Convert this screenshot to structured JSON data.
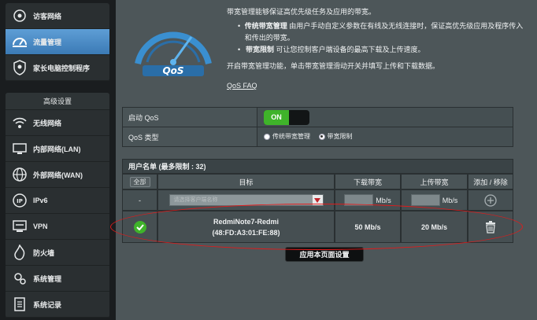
{
  "sidebar": {
    "top_items": [
      {
        "label": "访客网络",
        "icon": "guest-network-icon"
      },
      {
        "label": "流量管理",
        "icon": "traffic-manager-icon",
        "active": true
      },
      {
        "label": "家长电脑控制程序",
        "icon": "parental-control-icon"
      }
    ],
    "advanced_header": "高级设置",
    "advanced_items": [
      {
        "label": "无线网络",
        "icon": "wireless-icon"
      },
      {
        "label": "内部网络(LAN)",
        "icon": "lan-icon"
      },
      {
        "label": "外部网络(WAN)",
        "icon": "wan-icon"
      },
      {
        "label": "IPv6",
        "icon": "ipv6-icon"
      },
      {
        "label": "VPN",
        "icon": "vpn-icon"
      },
      {
        "label": "防火墙",
        "icon": "firewall-icon"
      },
      {
        "label": "系统管理",
        "icon": "administration-icon"
      },
      {
        "label": "系统记录",
        "icon": "system-log-icon"
      }
    ]
  },
  "intro": {
    "line1": "带宽管理能够保证高优先级任务及应用的带宽。",
    "bullet1_title": "传统带宽管理",
    "bullet1_text": " 由用户手动自定义参数在有线及无线连接时，保证高优先级应用及程序传入和传出的带宽。",
    "bullet2_title": "带宽限制",
    "bullet2_text": " 可让您控制客户端设备的最高下载及上传速度。",
    "line2": "开启带宽管理功能，单击带宽管理滑动开关并填写上传和下载数据。",
    "faq": "QoS FAQ"
  },
  "form": {
    "enable_label": "启动 QoS",
    "toggle_on": "ON",
    "type_label": "QoS 类型",
    "type_options": [
      "传统带宽管理",
      "带宽限制"
    ],
    "type_selected": 1
  },
  "user_list": {
    "title": "用户名单 (最多限制 : 32)",
    "all_button": "全部",
    "columns": {
      "target": "目标",
      "download": "下载带宽",
      "upload": "上传带宽",
      "action": "添加 / 移除"
    },
    "add_row": {
      "dash": "-",
      "target_placeholder": "请选择客户端名称",
      "download_unit": "Mb/s",
      "upload_unit": "Mb/s"
    },
    "devices": [
      {
        "name": "RedmiNote7-Redmi",
        "mac": "(48:FD:A3:01:FE:88)",
        "download": "50 Mb/s",
        "upload": "20 Mb/s"
      }
    ]
  },
  "apply_button": "应用本页面设置",
  "colors": {
    "accent_blue": "#4a8ccc",
    "on_green": "#3fb32a",
    "highlight_red": "#e01b1b"
  }
}
